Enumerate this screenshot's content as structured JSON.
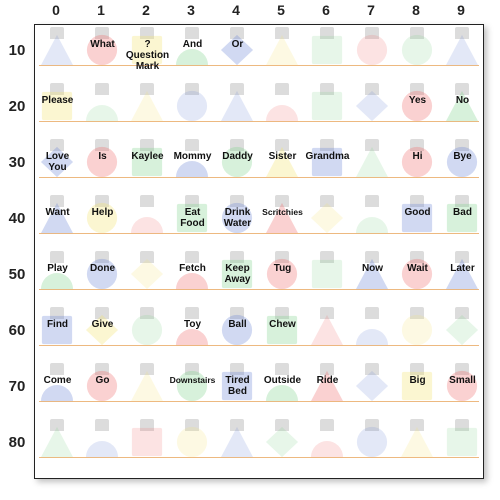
{
  "layout": {
    "cols": [
      "0",
      "1",
      "2",
      "3",
      "4",
      "5",
      "6",
      "7",
      "8",
      "9"
    ],
    "rows": [
      "10",
      "20",
      "30",
      "40",
      "50",
      "60",
      "70",
      "80"
    ]
  },
  "palette": [
    "red",
    "blue",
    "green",
    "yellow"
  ],
  "shapes": [
    "triangle",
    "circle",
    "halfcircle",
    "square",
    "diamond"
  ],
  "cells": {
    "10": [
      "",
      "What",
      "?\nQuestion\nMark",
      "And",
      "Or",
      "",
      "",
      "",
      "",
      ""
    ],
    "20": [
      "Please",
      "",
      "",
      "",
      "",
      "",
      "",
      "",
      "Yes",
      "No"
    ],
    "30": [
      "Love\nYou",
      "Is",
      "Kaylee",
      "Mommy",
      "Daddy",
      "Sister",
      "Grandma",
      "",
      "Hi",
      "Bye"
    ],
    "40": [
      "Want",
      "Help",
      "",
      "Eat\nFood",
      "Drink\nWater",
      "Scritchies",
      "",
      "",
      "Good",
      "Bad"
    ],
    "50": [
      "Play",
      "Done",
      "",
      "Fetch",
      "Keep\nAway",
      "Tug",
      "",
      "Now",
      "Wait",
      "Later"
    ],
    "60": [
      "Find",
      "Give",
      "",
      "Toy",
      "Ball",
      "Chew",
      "",
      "",
      "",
      ""
    ],
    "70": [
      "Come",
      "Go",
      "",
      "Downstairs",
      "Tired\nBed",
      "Outside",
      "Ride",
      "",
      "Big",
      "Small"
    ],
    "80": [
      "",
      "",
      "",
      "",
      "",
      "",
      "",
      "",
      "",
      ""
    ]
  },
  "bgPattern": [
    [
      "blue-triangle",
      "red-circle",
      "yellow-square",
      "green-halfcircle",
      "blue-diamond",
      "yellow-triangle",
      "green-square",
      "red-circle",
      "green-circle",
      "blue-triangle"
    ],
    [
      "yellow-square",
      "green-halfcircle",
      "yellow-triangle",
      "blue-circle",
      "blue-triangle",
      "red-halfcircle",
      "green-square",
      "blue-diamond",
      "red-circle",
      "green-triangle"
    ],
    [
      "blue-diamond",
      "red-circle",
      "green-square",
      "blue-halfcircle",
      "green-circle",
      "yellow-triangle",
      "blue-square",
      "green-triangle",
      "red-circle",
      "blue-circle"
    ],
    [
      "blue-triangle",
      "yellow-circle",
      "red-halfcircle",
      "green-square",
      "blue-circle",
      "red-triangle",
      "yellow-diamond",
      "green-halfcircle",
      "blue-square",
      "green-square"
    ],
    [
      "green-halfcircle",
      "blue-circle",
      "yellow-diamond",
      "red-halfcircle",
      "green-square",
      "red-circle",
      "green-square",
      "blue-triangle",
      "red-circle",
      "blue-triangle"
    ],
    [
      "blue-square",
      "yellow-diamond",
      "green-circle",
      "red-halfcircle",
      "blue-circle",
      "green-square",
      "red-triangle",
      "blue-halfcircle",
      "yellow-circle",
      "green-diamond"
    ],
    [
      "blue-halfcircle",
      "red-circle",
      "yellow-triangle",
      "green-circle",
      "blue-square",
      "green-halfcircle",
      "red-triangle",
      "blue-diamond",
      "yellow-square",
      "red-circle"
    ],
    [
      "green-triangle",
      "blue-halfcircle",
      "red-square",
      "yellow-circle",
      "blue-triangle",
      "green-diamond",
      "red-halfcircle",
      "blue-circle",
      "yellow-triangle",
      "green-square"
    ]
  ]
}
